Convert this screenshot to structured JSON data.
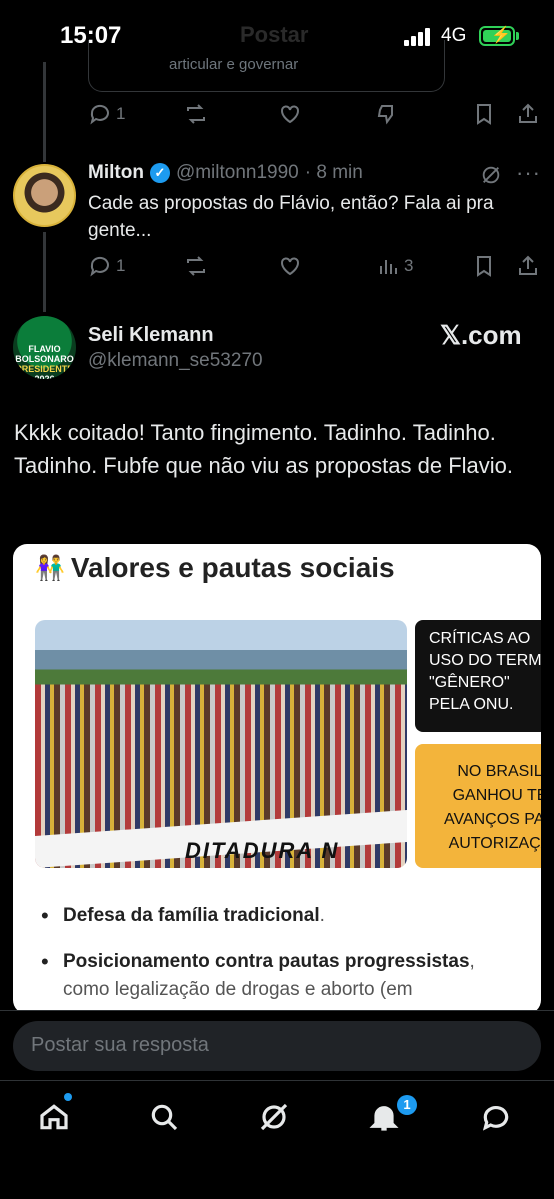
{
  "status_bar": {
    "time": "15:07",
    "network": "4G",
    "ghost_title": "Postar"
  },
  "quoted_snippet": "articular e governar",
  "top_actions": {
    "reply_count": "1"
  },
  "reply": {
    "name": "Milton",
    "handle": "@miltonn1990",
    "time": "· 8 min",
    "text": "Cade as propostas do Flávio, então? Fala ai pra gente...",
    "reply_count": "1",
    "views": "3"
  },
  "main_post": {
    "name": "Seli Klemann",
    "handle": "@klemann_se53270",
    "source": "𝕏.com",
    "avatar_lines": [
      "FLAVIO",
      "BOLSONARO",
      "PRESIDENTE",
      "2026"
    ],
    "text": "Kkkk coitado! Tanto fingimento.  Tadinho. Tadinho.  Tadinho. Fubfe que não viu as propostas de Flavio."
  },
  "media": {
    "icon": "👫",
    "title": "Valores e pautas sociais",
    "banner_text": "DITADURA N",
    "comic_top": "CRÍTICAS AO\nUSO DO TERMO\n\"GÊNERO\"\nPELA ONU.",
    "comic_bottom": "NO BRASIL\nGANHOU TE\nAVANÇOS PAR\nAUTORIZAÇÃ",
    "bullets": [
      {
        "bold": "Defesa da família tradicional",
        "rest": "."
      },
      {
        "bold": "Posicionamento contra pautas progressistas",
        "rest": ",\ncomo legalização de drogas e aborto (em"
      }
    ]
  },
  "composer": {
    "placeholder": "Postar sua resposta"
  },
  "tab_bar": {
    "notifications_badge": "1"
  }
}
